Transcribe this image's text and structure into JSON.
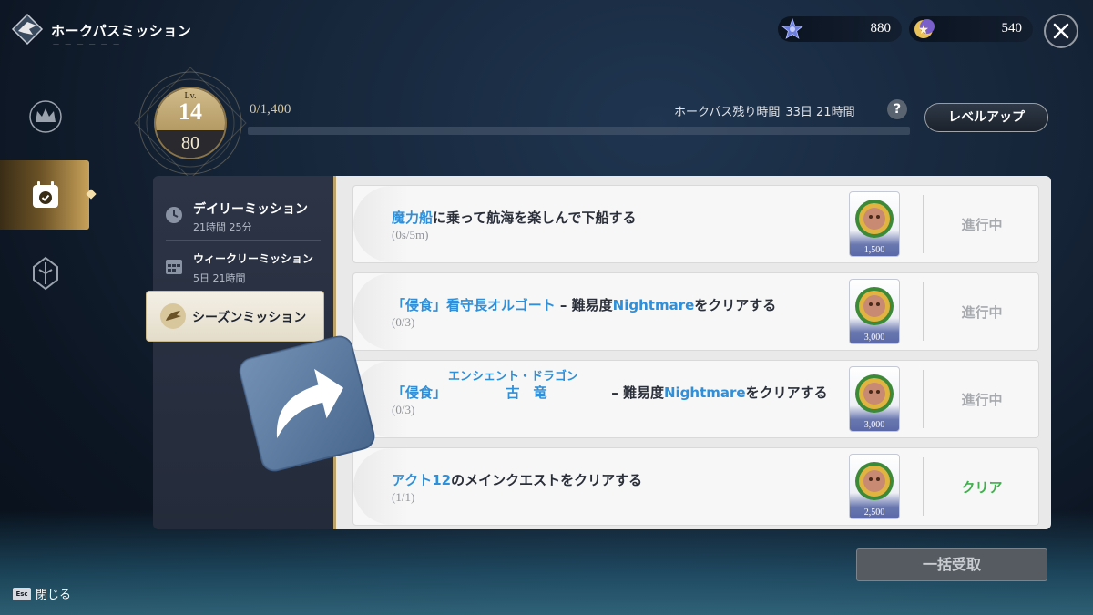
{
  "header": {
    "title": "ホークパスミッション",
    "close_icon": "close-icon"
  },
  "currencies": [
    {
      "icon": "blue-star-gem-icon",
      "value": "880"
    },
    {
      "icon": "moon-star-icon",
      "value": "540"
    }
  ],
  "sidebar": {
    "items": [
      {
        "icon": "crown-icon",
        "active": false
      },
      {
        "icon": "calendar-check-icon",
        "active": true
      },
      {
        "icon": "crest-shield-icon",
        "active": false
      }
    ]
  },
  "level": {
    "label": "Lv.",
    "current": "14",
    "next": "80",
    "xp_text": "0/1,400",
    "xp_fraction": 0,
    "remaining_label": "ホークパス残り時間",
    "remaining_value": "33日 21時間",
    "help_label": "?",
    "levelup_label": "レベルアップ"
  },
  "tabs": [
    {
      "label": "デイリーミッション",
      "sub": "21時間 25分",
      "icon": "clock-icon"
    },
    {
      "label": "ウィークリーミッション",
      "sub": "5日 21時間",
      "icon": "calendar-icon"
    },
    {
      "label": "シーズンミッション",
      "icon": "season-icon",
      "active": true
    }
  ],
  "missions": [
    {
      "title_hl": "魔力船",
      "title_rest": "に乗って航海を楽しんで下船する",
      "progress": "(0s/5m)",
      "reward_amount": "1,500",
      "status": "進行中"
    },
    {
      "title_hl": "「侵食」看守長オルゴート",
      "title_mid": " – 難易度",
      "title_hl2": "Nightmare",
      "title_rest": "をクリアする",
      "progress": "(0/3)",
      "reward_amount": "3,000",
      "status": "進行中"
    },
    {
      "title_hl": "「侵食」",
      "title_ruby": "エンシェント・ドラゴン",
      "title_base": "古　竜",
      "title_mid": " – 難易度",
      "title_hl2": "Nightmare",
      "title_rest": "をクリアする",
      "progress": "(0/3)",
      "reward_amount": "3,000",
      "status": "進行中"
    },
    {
      "title_hl": "アクト12",
      "title_rest": "のメインクエストをクリアする",
      "progress": "(1/1)",
      "reward_amount": "2,500",
      "status": "クリア"
    }
  ],
  "claim_all_label": "一括受取",
  "footer": {
    "key": "Esc",
    "label": "閉じる"
  },
  "colors": {
    "accent_blue": "#2f8fd8",
    "done_green": "#3fb04c",
    "gold": "#d8c79c"
  }
}
